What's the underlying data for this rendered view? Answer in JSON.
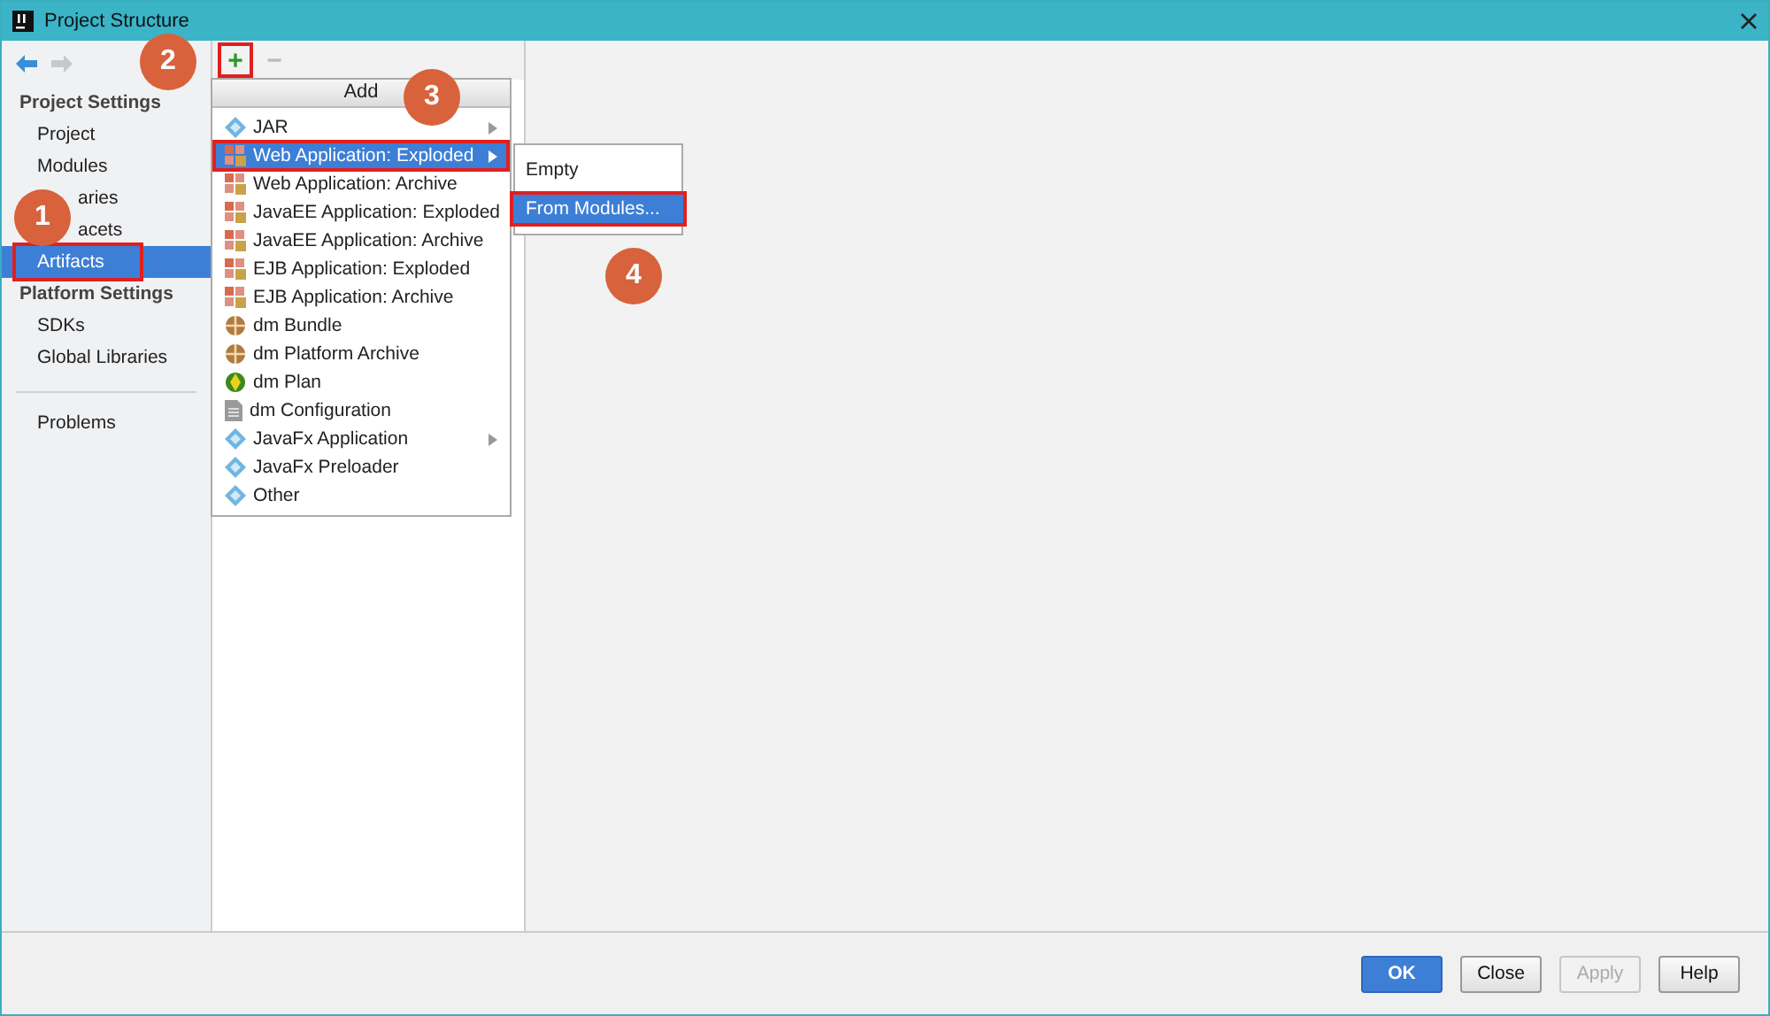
{
  "window": {
    "title": "Project Structure"
  },
  "sidebar": {
    "sections": [
      {
        "header": "Project Settings",
        "items": [
          {
            "label": "Project",
            "selected": false,
            "highlighted": false
          },
          {
            "label": "Modules",
            "selected": false,
            "highlighted": false
          },
          {
            "label": "aries",
            "selected": false,
            "highlighted": false
          },
          {
            "label": "acets",
            "selected": false,
            "highlighted": false
          },
          {
            "label": "Artifacts",
            "selected": true,
            "highlighted": true,
            "callout": "1"
          }
        ]
      },
      {
        "header": "Platform Settings",
        "items": [
          {
            "label": "SDKs",
            "selected": false,
            "highlighted": false
          },
          {
            "label": "Global Libraries",
            "selected": false,
            "highlighted": false
          }
        ]
      },
      {
        "items": [
          {
            "label": "Problems",
            "selected": false,
            "highlighted": false
          }
        ]
      }
    ]
  },
  "toolbar": {
    "add": {
      "label": "+",
      "highlighted": true,
      "callout": "2"
    },
    "remove": {
      "label": "−",
      "disabled": true
    }
  },
  "add_menu": {
    "title": "Add",
    "callout": "3",
    "items": [
      {
        "label": "JAR",
        "kind": "diamond",
        "submenu": true,
        "selected": false,
        "highlighted": false
      },
      {
        "label": "Web Application: Exploded",
        "kind": "archive",
        "submenu": true,
        "selected": true,
        "highlighted": true
      },
      {
        "label": "Web Application: Archive",
        "kind": "archive",
        "submenu": false,
        "selected": false,
        "highlighted": false
      },
      {
        "label": "JavaEE Application: Exploded",
        "kind": "archive",
        "submenu": false,
        "selected": false,
        "highlighted": false
      },
      {
        "label": "JavaEE Application: Archive",
        "kind": "archive",
        "submenu": false,
        "selected": false,
        "highlighted": false
      },
      {
        "label": "EJB Application: Exploded",
        "kind": "archive",
        "submenu": false,
        "selected": false,
        "highlighted": false
      },
      {
        "label": "EJB Application: Archive",
        "kind": "archive",
        "submenu": false,
        "selected": false,
        "highlighted": false
      },
      {
        "label": "dm Bundle",
        "kind": "bundle",
        "submenu": false,
        "selected": false,
        "highlighted": false
      },
      {
        "label": "dm Platform Archive",
        "kind": "bundle",
        "submenu": false,
        "selected": false,
        "highlighted": false
      },
      {
        "label": "dm Plan",
        "kind": "plan",
        "submenu": false,
        "selected": false,
        "highlighted": false
      },
      {
        "label": "dm Configuration",
        "kind": "file",
        "submenu": false,
        "selected": false,
        "highlighted": false
      },
      {
        "label": "JavaFx Application",
        "kind": "diamond",
        "submenu": true,
        "selected": false,
        "highlighted": false
      },
      {
        "label": "JavaFx Preloader",
        "kind": "diamond",
        "submenu": false,
        "selected": false,
        "highlighted": false
      },
      {
        "label": "Other",
        "kind": "diamond",
        "submenu": false,
        "selected": false,
        "highlighted": false
      }
    ]
  },
  "submenu": {
    "items": [
      {
        "label": "Empty",
        "selected": false,
        "highlighted": false
      },
      {
        "label": "From Modules...",
        "selected": true,
        "highlighted": true,
        "callout": "4"
      }
    ]
  },
  "buttons": [
    {
      "label": "OK",
      "primary": true,
      "disabled": false
    },
    {
      "label": "Close",
      "primary": false,
      "disabled": false
    },
    {
      "label": "Apply",
      "primary": false,
      "disabled": true
    },
    {
      "label": "Help",
      "primary": false,
      "disabled": false
    }
  ]
}
